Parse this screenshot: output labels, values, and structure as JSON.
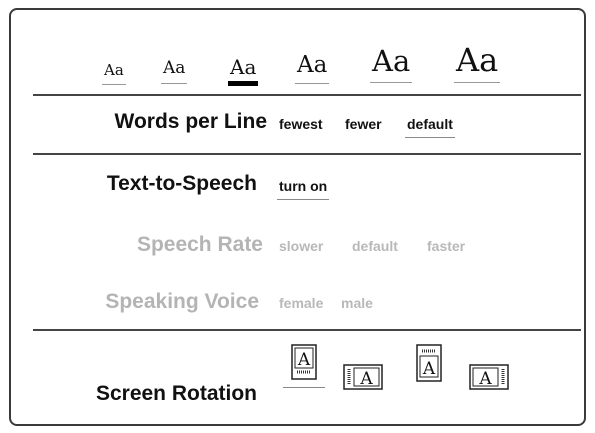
{
  "font_sizes": {
    "glyph": "Aa",
    "options": [
      "Aa",
      "Aa",
      "Aa",
      "Aa",
      "Aa",
      "Aa"
    ],
    "selected_index": 2
  },
  "words_per_line": {
    "label": "Words per Line",
    "options": [
      "fewest",
      "fewer",
      "default"
    ],
    "selected": "default"
  },
  "text_to_speech": {
    "label": "Text-to-Speech",
    "action": "turn on"
  },
  "speech_rate": {
    "label": "Speech Rate",
    "options": [
      "slower",
      "default",
      "faster"
    ],
    "enabled": false
  },
  "speaking_voice": {
    "label": "Speaking Voice",
    "options": [
      "female",
      "male"
    ],
    "enabled": false
  },
  "screen_rotation": {
    "label": "Screen Rotation",
    "glyph": "A",
    "icons": [
      "portrait-icon",
      "landscape-left-icon",
      "portrait-inverted-icon",
      "landscape-right-icon"
    ],
    "selected_index": 0
  }
}
